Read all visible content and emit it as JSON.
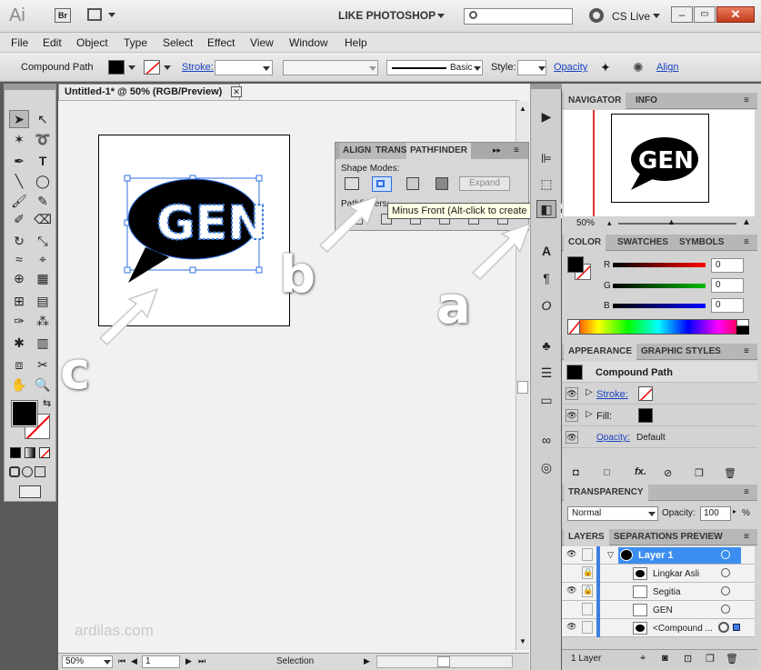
{
  "app": {
    "logo": "Ai",
    "bridge_btn": "Br",
    "workspace_label": "LIKE PHOTOSHOP",
    "cs_live": "CS Live"
  },
  "menu": [
    "File",
    "Edit",
    "Object",
    "Type",
    "Select",
    "Effect",
    "View",
    "Window",
    "Help"
  ],
  "control": {
    "selection_type": "Compound Path",
    "stroke_label": "Stroke:",
    "brush_label": "Basic",
    "style_label": "Style:",
    "opacity_label": "Opacity",
    "align_label": "Align"
  },
  "document": {
    "tab_title": "Untitled-1* @ 50% (RGB/Preview)",
    "zoom": "50%",
    "page": "1",
    "status": "Selection",
    "artwork_text": "GEN"
  },
  "pathfinder": {
    "tabs": [
      "ALIGN",
      "TRANS",
      "PATHFINDER"
    ],
    "shape_modes_label": "Shape Modes:",
    "pathfinders_label": "Pathfinders:",
    "expand_button": "Expand",
    "tooltip": "Minus Front (Alt-click to create a compound Shape and subtract from shape"
  },
  "annotations": [
    "a",
    "b",
    "c"
  ],
  "watermark": "ardilas.com",
  "navigator": {
    "tabs": [
      "NAVIGATOR",
      "INFO"
    ],
    "zoom": "50%",
    "preview_text": "GEN"
  },
  "color": {
    "tabs": [
      "COLOR",
      "SWATCHES",
      "SYMBOLS"
    ],
    "r_label": "R",
    "g_label": "G",
    "b_label": "B",
    "r": "0",
    "g": "0",
    "b": "0"
  },
  "appearance": {
    "tabs": [
      "APPEARANCE",
      "GRAPHIC STYLES"
    ],
    "title": "Compound Path",
    "stroke_label": "Stroke:",
    "fill_label": "Fill:",
    "opacity_label": "Opacity:",
    "opacity_value": "Default",
    "fx": "fx."
  },
  "transparency": {
    "title": "TRANSPARENCY",
    "blend_mode": "Normal",
    "opacity_label": "Opacity:",
    "opacity_value": "100",
    "percent": "%"
  },
  "layers": {
    "tabs": [
      "LAYERS",
      "SEPARATIONS PREVIEW"
    ],
    "items": [
      {
        "name": "Layer 1"
      },
      {
        "name": "Lingkar Asli"
      },
      {
        "name": "Segitia"
      },
      {
        "name": "GEN"
      },
      {
        "name": "<Compound ..."
      }
    ],
    "count": "1 Layer"
  },
  "colors": {
    "accent_blue": "#3d7fe0",
    "selection_blue": "#2c6fe3",
    "layer_selected": "#3b8ef0"
  }
}
